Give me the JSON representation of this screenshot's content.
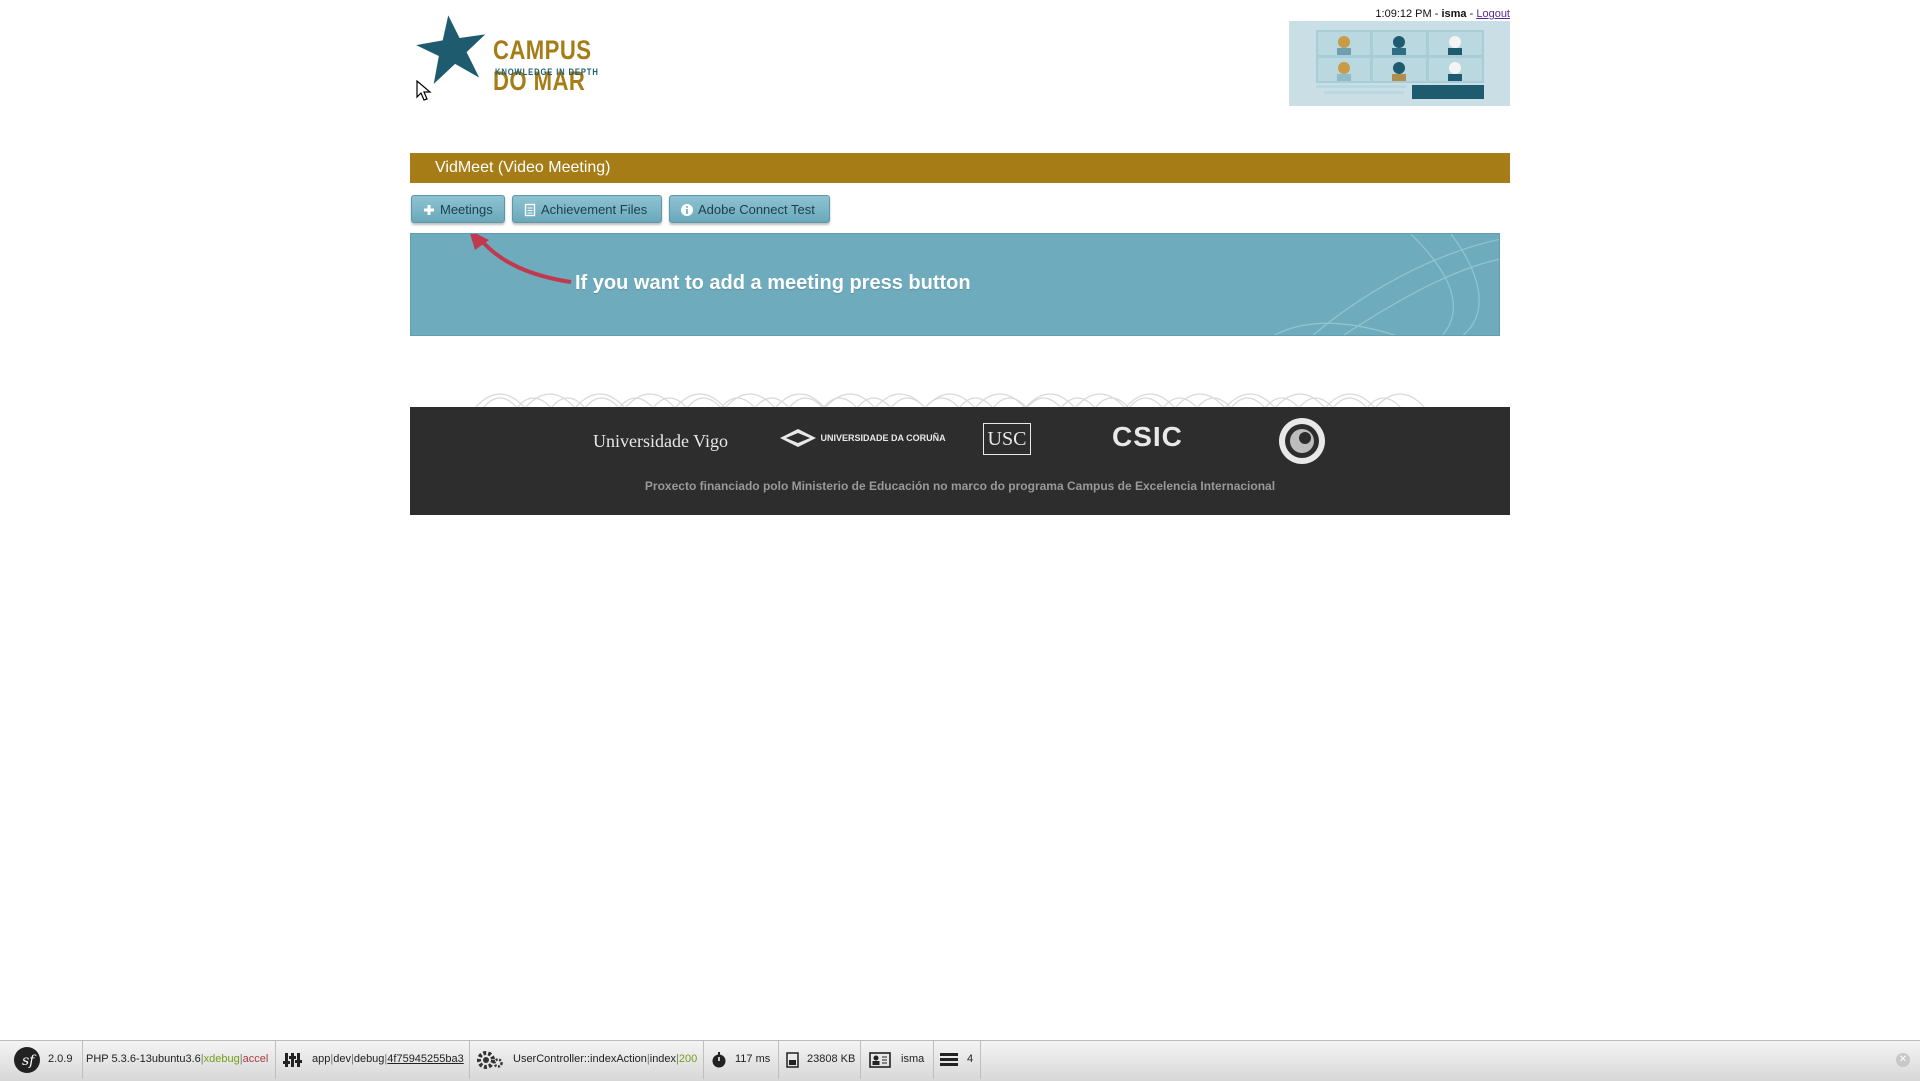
{
  "header": {
    "logo_title": "CAMPUS DO MAR",
    "logo_subtitle": "KNOWLEDGE IN DEPTH",
    "time": "1:09:12 PM",
    "user": "isma",
    "logout_label": "Logout"
  },
  "app_title": "VidMeet (Video Meeting)",
  "tabs": [
    {
      "label": "Meetings",
      "icon": "plus-icon"
    },
    {
      "label": "Achievement Files",
      "icon": "document-icon"
    },
    {
      "label": "Adobe Connect Test",
      "icon": "info-icon"
    }
  ],
  "info_message": "If you want to add a meeting press button",
  "footer": {
    "logos": [
      "Universidade Vigo",
      "UNIVERSIDADE DA CORUÑA",
      "USC",
      "CSIC"
    ],
    "note": "Proxecto financiado polo Ministerio de Educación no marco do programa Campus de Excelencia Internacional"
  },
  "debug_toolbar": {
    "symfony_version": "2.0.9",
    "php_version": "PHP 5.3.6-13ubuntu3.6",
    "php_ext_xdebug": "xdebug",
    "php_ext_accel": "accel",
    "config_app": "app",
    "config_env": "dev",
    "config_debug": "debug",
    "token": "4f75945255ba3",
    "controller": "UserController::indexAction",
    "route": "index",
    "status": "200",
    "time": "117 ms",
    "memory": "23808 KB",
    "user": "isma",
    "queries": "4"
  },
  "colors": {
    "brand_gold": "#a67c16",
    "panel_blue": "#6eacbd",
    "footer_dark": "#2d2d2d"
  }
}
